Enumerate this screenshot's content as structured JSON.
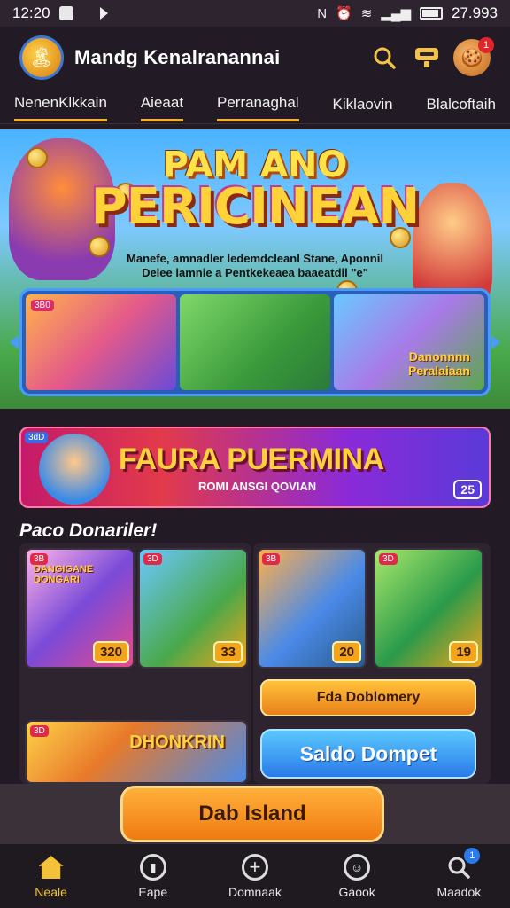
{
  "status_bar": {
    "time": "12:20",
    "right_text": "27.993"
  },
  "header": {
    "title": "Mandg Kenalranannai",
    "avatar_badge": "1"
  },
  "tabs": [
    {
      "label": "NenenKlkkain",
      "active": true
    },
    {
      "label": "Aieaat",
      "active": true
    },
    {
      "label": "Perranaghal",
      "active": true
    },
    {
      "label": "Kiklaovin",
      "active": false
    },
    {
      "label": "Blalcoftaih",
      "active": false
    }
  ],
  "hero": {
    "title_line1": "PAM ANO",
    "title_line2": "PERICINEAN",
    "subtitle_line1": "Manefe, amnadler ledemdcleanl Stane, Aponnil",
    "subtitle_line2": "Delee lamnie a Pentkekeaea baaeatdil \"e\""
  },
  "carousel": [
    {
      "badge": "3B0",
      "label": ""
    },
    {
      "badge": "",
      "label": ""
    },
    {
      "badge": "",
      "label": "Danonnnn\nPeralaiaan"
    }
  ],
  "promo": {
    "tag": "3dD",
    "title": "FAURA PUERMINA",
    "subtitle": "ROMI ANSGI QOVIAN",
    "badge": "25"
  },
  "section": {
    "title": "Paco Donariler!"
  },
  "cards": [
    {
      "tag": "3B",
      "title": "DANGIGANE\nDONGARI",
      "price": "320"
    },
    {
      "tag": "3D",
      "price": "33"
    },
    {
      "tag": "3B",
      "price": "20"
    },
    {
      "tag": "3D",
      "price": "19"
    },
    {
      "tag": "3D",
      "title": "DHONKRIN"
    }
  ],
  "buttons": {
    "gold": "Fda Doblomery",
    "blue": "Saldo Dompet",
    "cta": "Dab Island"
  },
  "nav": [
    {
      "label": "Neale",
      "icon": "home-icon",
      "active": true
    },
    {
      "label": "Eape",
      "icon": "shop-icon",
      "active": false
    },
    {
      "label": "Domnaak",
      "icon": "plus-circle-icon",
      "active": false
    },
    {
      "label": "Gaook",
      "icon": "game-icon",
      "active": false
    },
    {
      "label": "Maadok",
      "icon": "search-icon",
      "active": false,
      "badge": "1"
    }
  ],
  "colors": {
    "accent": "#f3c23a",
    "blue": "#2a7ae8",
    "bg": "#221a24"
  }
}
